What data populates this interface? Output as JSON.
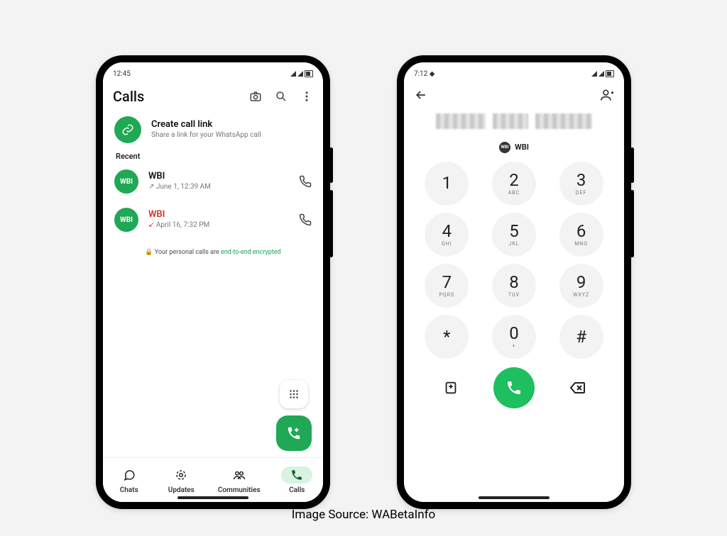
{
  "left": {
    "status": {
      "time": "12:45"
    },
    "title": "Calls",
    "create": {
      "title": "Create call link",
      "sub": "Share a link for your WhatsApp call"
    },
    "recentLabel": "Recent",
    "calls": [
      {
        "avatar": "WBI",
        "name": "WBI",
        "time": "June 1, 12:39 AM",
        "type": "outgoing"
      },
      {
        "avatar": "WBI",
        "name": "WBI",
        "time": "April 16, 7:32 PM",
        "type": "missed"
      }
    ],
    "encrypt": {
      "pre": " Your personal calls are ",
      "link": "end-to-end encrypted"
    },
    "nav": [
      "Chats",
      "Updates",
      "Communities",
      "Calls"
    ]
  },
  "right": {
    "status": {
      "time": "7:12"
    },
    "suggestion": "WBI",
    "keys": [
      {
        "d": "1",
        "l": ""
      },
      {
        "d": "2",
        "l": "ABC"
      },
      {
        "d": "3",
        "l": "DEF"
      },
      {
        "d": "4",
        "l": "GHI"
      },
      {
        "d": "5",
        "l": "JKL"
      },
      {
        "d": "6",
        "l": "MNO"
      },
      {
        "d": "7",
        "l": "PQRS"
      },
      {
        "d": "8",
        "l": "TUV"
      },
      {
        "d": "9",
        "l": "WXYZ"
      },
      {
        "d": "*"
      },
      {
        "d": "0",
        "l": "+"
      },
      {
        "d": "#"
      }
    ]
  },
  "caption": "Image Source: WABetaInfo"
}
